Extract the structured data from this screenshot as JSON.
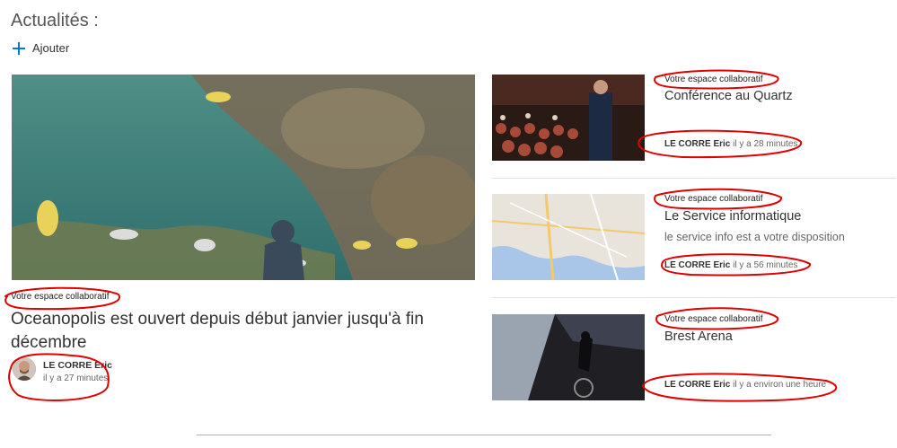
{
  "section": {
    "title": "Actualités :",
    "add_label": "Ajouter"
  },
  "hero": {
    "site": "Votre espace collaboratif",
    "headline": "Oceanopolis est ouvert depuis début janvier jusqu'à fin décembre",
    "author": "LE CORRE Eric",
    "time": "il y a 27 minutes"
  },
  "cards": [
    {
      "site": "Votre espace collaboratif",
      "headline": "Conférence au Quartz",
      "description": "",
      "author": "LE CORRE Eric",
      "time": "il y a 28 minutes"
    },
    {
      "site": "Votre espace collaboratif",
      "headline": "Le Service informatique",
      "description": "le service info est a votre disposition",
      "author": "LE CORRE Eric",
      "time": "il y a 56 minutes"
    },
    {
      "site": "Votre espace collaboratif",
      "headline": "Brest Arena",
      "description": "",
      "author": "LE CORRE Eric",
      "time": "il y a environ une heure"
    }
  ],
  "icons": {
    "add": "plus-icon"
  },
  "colors": {
    "accent": "#0078d4",
    "annotation": "#e00000"
  }
}
